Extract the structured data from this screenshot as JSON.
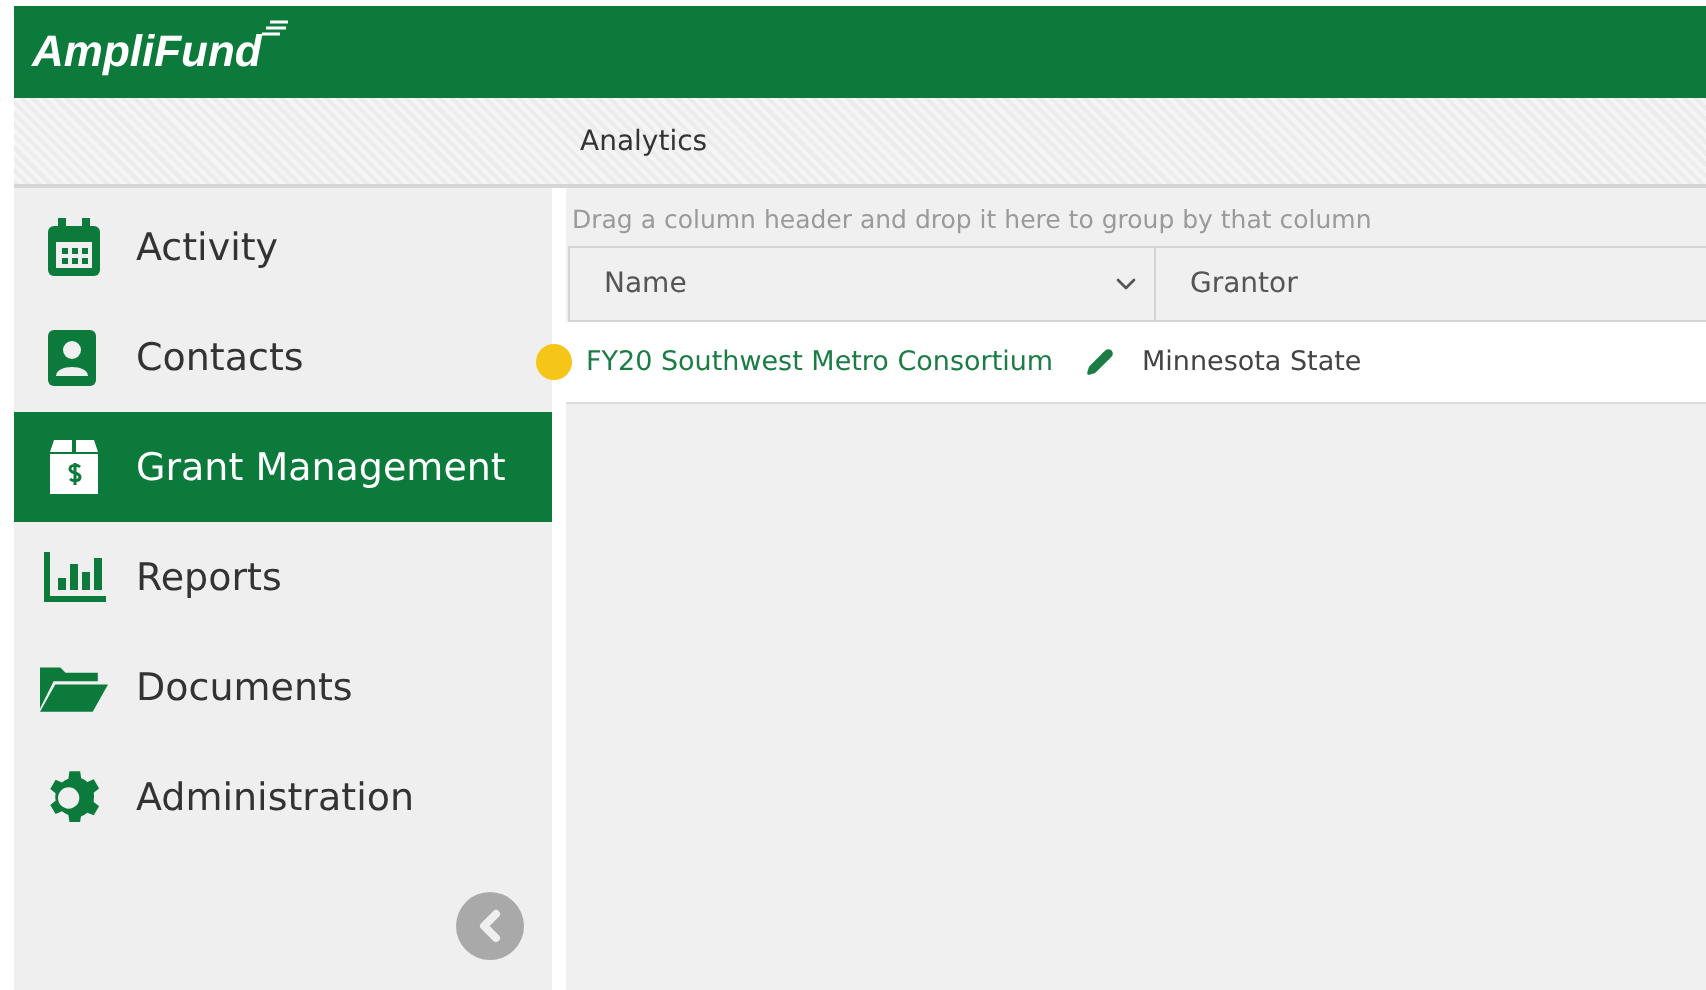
{
  "header": {
    "logo": "AmpliFund"
  },
  "breadcrumb": "Analytics",
  "sidebar": {
    "items": [
      {
        "label": "Activity",
        "selected": false
      },
      {
        "label": "Contacts",
        "selected": false
      },
      {
        "label": "Grant Management",
        "selected": true
      },
      {
        "label": "Reports",
        "selected": false
      },
      {
        "label": "Documents",
        "selected": false
      },
      {
        "label": "Administration",
        "selected": false
      }
    ]
  },
  "grid": {
    "group_hint": "Drag a column header and drop it here to group by that column",
    "columns": [
      "Name",
      "Grantor"
    ],
    "rows": [
      {
        "name": "FY20 Southwest Metro Consortium",
        "grantor": "Minnesota State",
        "color": "#f5c518"
      }
    ]
  }
}
